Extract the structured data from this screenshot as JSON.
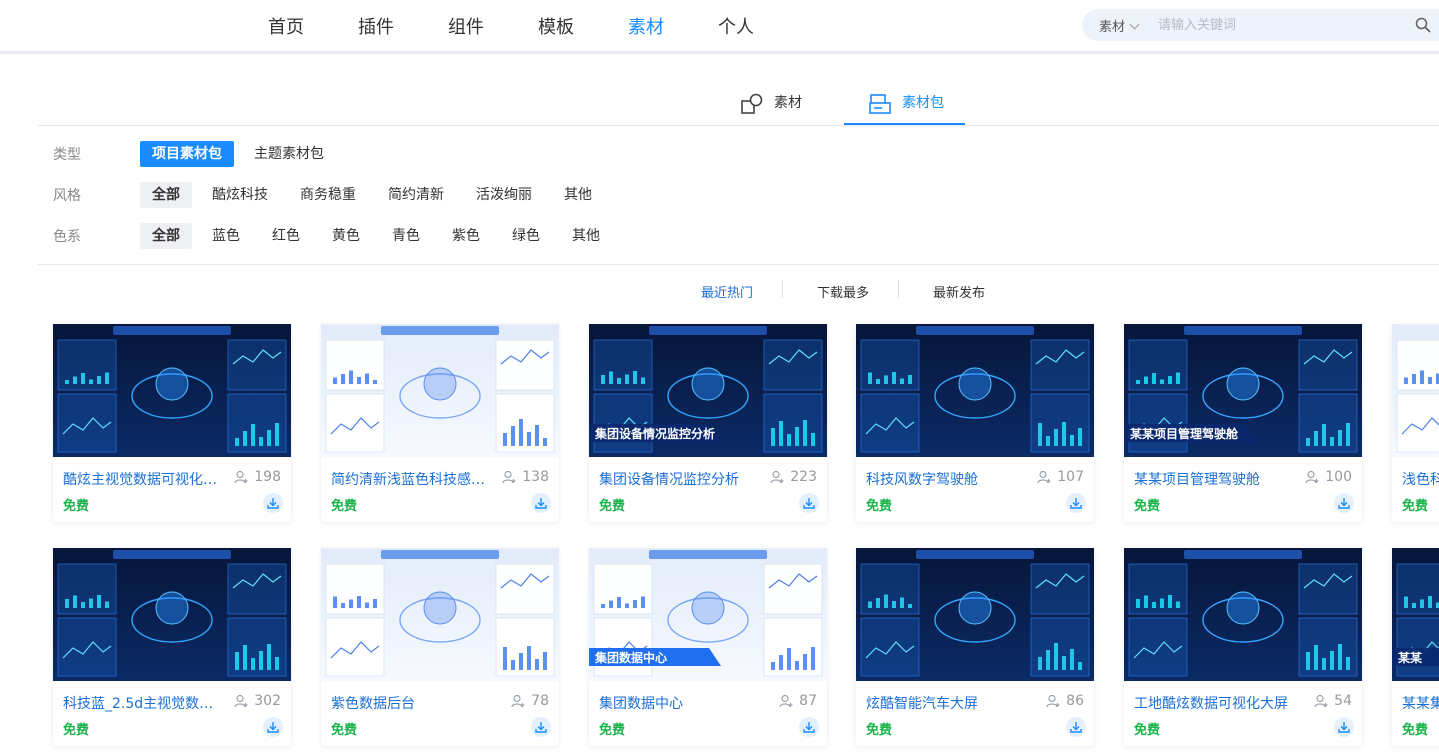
{
  "nav": {
    "items": [
      {
        "label": "首页",
        "active": false
      },
      {
        "label": "插件",
        "active": false
      },
      {
        "label": "组件",
        "active": false
      },
      {
        "label": "模板",
        "active": false
      },
      {
        "label": "素材",
        "active": true
      },
      {
        "label": "个人",
        "active": false
      }
    ],
    "search": {
      "scope": "素材",
      "placeholder": "请输入关键词",
      "value": ""
    }
  },
  "type_tabs": [
    {
      "label": "素材",
      "icon": "shapes-icon",
      "active": false
    },
    {
      "label": "素材包",
      "icon": "package-icon",
      "active": true
    }
  ],
  "filters": {
    "type": {
      "label": "类型",
      "options": [
        "项目素材包",
        "主题素材包"
      ],
      "selected": "项目素材包"
    },
    "style": {
      "label": "风格",
      "options": [
        "全部",
        "酷炫科技",
        "商务稳重",
        "简约清新",
        "活泼绚丽",
        "其他"
      ],
      "selected": "全部"
    },
    "color": {
      "label": "色系",
      "options": [
        "全部",
        "蓝色",
        "红色",
        "黄色",
        "青色",
        "紫色",
        "绿色",
        "其他"
      ],
      "selected": "全部"
    }
  },
  "sort": {
    "options": [
      "最近热门",
      "下载最多",
      "最新发布"
    ],
    "selected": "最近热门"
  },
  "colors": {
    "accent": "#1a8cff",
    "free": "#19b34a",
    "title": "#1a6fd6"
  },
  "cards": [
    {
      "title": "酷炫主视觉数据可视化看板",
      "count": "198",
      "price": "免费",
      "theme": "dark",
      "banner": ""
    },
    {
      "title": "简约清新浅蓝色科技感后...",
      "count": "138",
      "price": "免费",
      "theme": "light",
      "banner": ""
    },
    {
      "title": "集团设备情况监控分析",
      "count": "223",
      "price": "免费",
      "theme": "dark",
      "banner": "集团设备情况监控分析"
    },
    {
      "title": "科技风数字驾驶舱",
      "count": "107",
      "price": "免费",
      "theme": "dark",
      "banner": ""
    },
    {
      "title": "某某项目管理驾驶舱",
      "count": "100",
      "price": "免费",
      "theme": "dark",
      "banner": "某某项目管理驾驶舱"
    },
    {
      "title": "浅色科",
      "count": "",
      "price": "免费",
      "theme": "light",
      "banner": ""
    },
    {
      "title": "科技蓝_2.5d主视觉数据...",
      "count": "302",
      "price": "免费",
      "theme": "dark",
      "banner": ""
    },
    {
      "title": "紫色数据后台",
      "count": "78",
      "price": "免费",
      "theme": "light",
      "banner": ""
    },
    {
      "title": "集团数据中心",
      "count": "87",
      "price": "免费",
      "theme": "light",
      "banner": "集团数据中心"
    },
    {
      "title": "炫酷智能汽车大屏",
      "count": "86",
      "price": "免费",
      "theme": "dark",
      "banner": ""
    },
    {
      "title": "工地酷炫数据可视化大屏",
      "count": "54",
      "price": "免费",
      "theme": "dark",
      "banner": ""
    },
    {
      "title": "某某集",
      "count": "",
      "price": "免费",
      "theme": "dark",
      "banner": "某某"
    }
  ]
}
